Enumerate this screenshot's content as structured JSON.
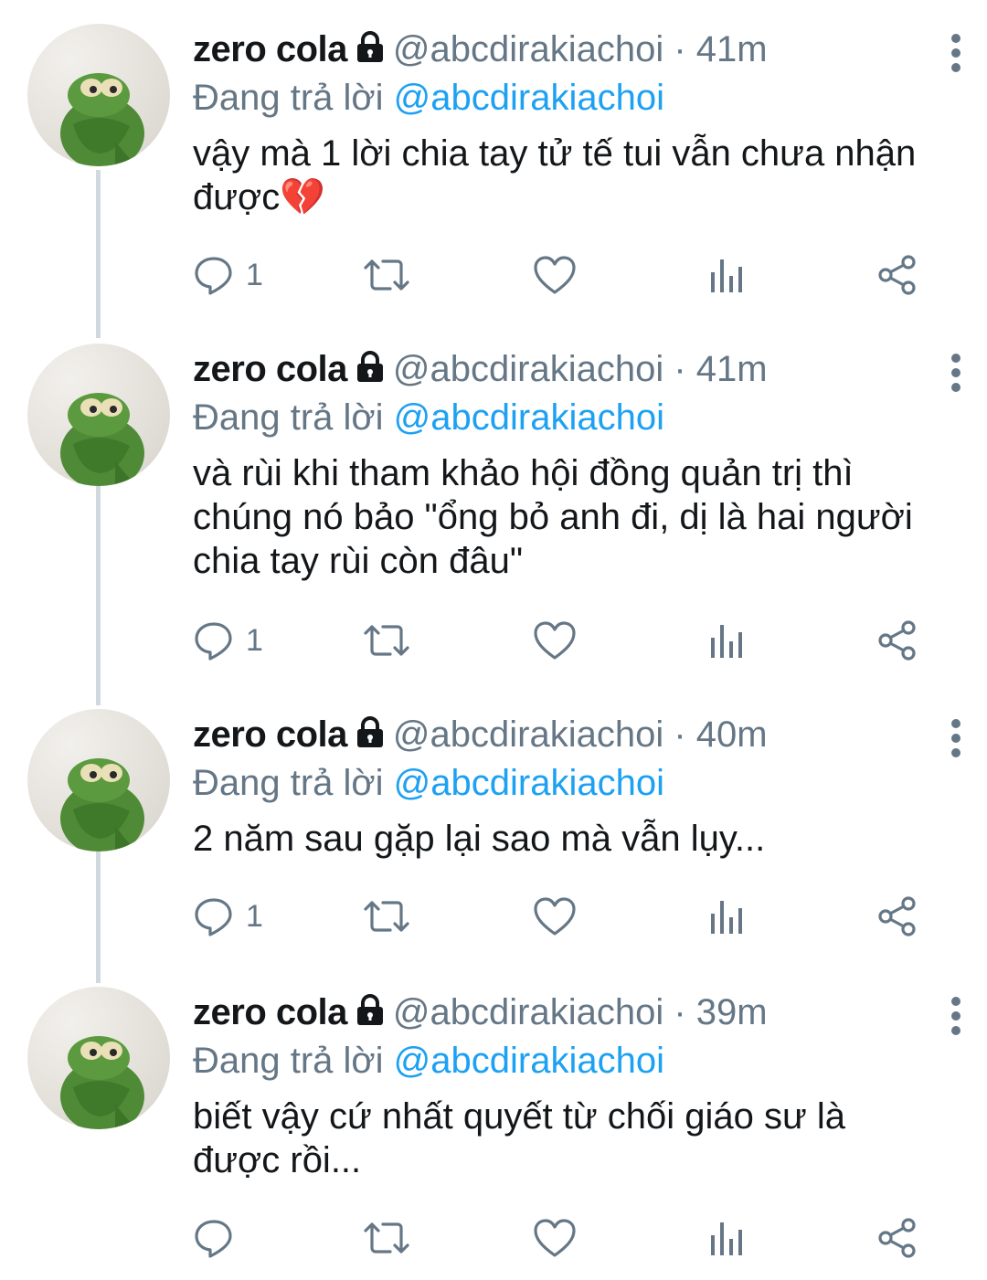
{
  "colors": {
    "accent": "#1da1f2",
    "muted": "#657786",
    "text": "#14171a",
    "thread_line": "#cfd9de"
  },
  "tweets": [
    {
      "name": "zero cola",
      "handle": "@abcdirakiachoi",
      "dot": "·",
      "time": "41m",
      "replying_prefix": "Đang trả lời",
      "replying_to": "@abcdirakiachoi",
      "lines": [
        "vậy mà 1 lời chia tay tử tế tui vẫn chưa nhận",
        "được💔"
      ],
      "reply_count": "1"
    },
    {
      "name": "zero cola",
      "handle": "@abcdirakiachoi",
      "dot": "·",
      "time": "41m",
      "replying_prefix": "Đang trả lời",
      "replying_to": "@abcdirakiachoi",
      "lines": [
        "và rùi khi tham khảo hội đồng quản trị thì",
        "chúng nó bảo \"ổng bỏ anh đi, dị là hai người",
        "chia tay rùi còn đâu\""
      ],
      "reply_count": "1"
    },
    {
      "name": "zero cola",
      "handle": "@abcdirakiachoi",
      "dot": "·",
      "time": "40m",
      "replying_prefix": "Đang trả lời",
      "replying_to": "@abcdirakiachoi",
      "lines": [
        "2 năm sau gặp lại sao mà vẫn lụy..."
      ],
      "reply_count": "1"
    },
    {
      "name": "zero cola",
      "handle": "@abcdirakiachoi",
      "dot": "·",
      "time": "39m",
      "replying_prefix": "Đang trả lời",
      "replying_to": "@abcdirakiachoi",
      "lines": [
        "biết vậy cứ nhất quyết từ chối giáo sư là",
        "được rồi..."
      ],
      "reply_count": ""
    }
  ],
  "icons": {
    "lock": "lock-icon",
    "more": "more-vertical-icon",
    "reply": "reply-icon",
    "retweet": "retweet-icon",
    "like": "heart-icon",
    "analytics": "analytics-icon",
    "share": "share-icon"
  }
}
